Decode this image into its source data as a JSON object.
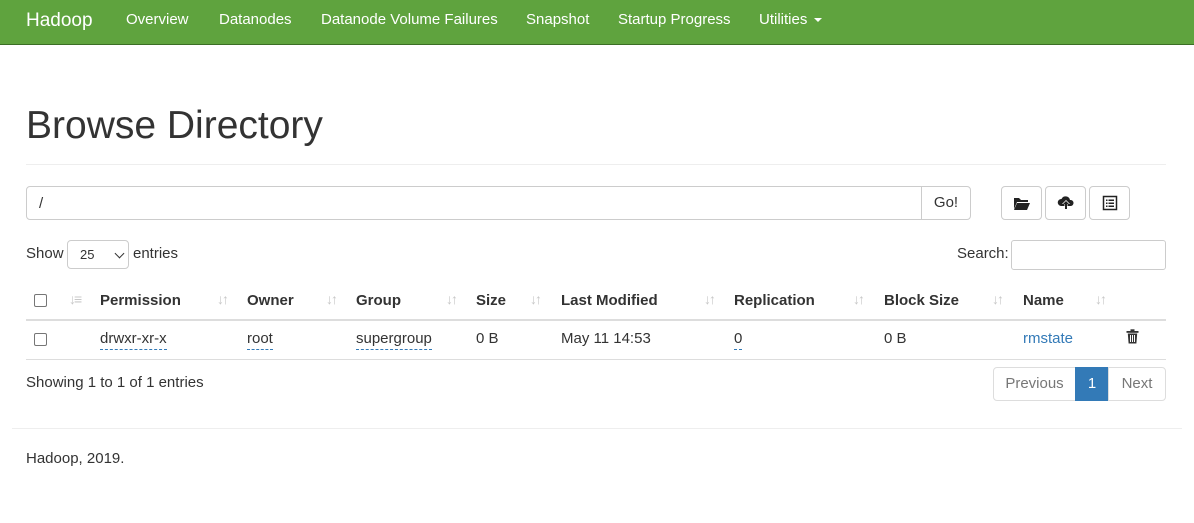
{
  "navbar": {
    "brand": "Hadoop",
    "items": [
      "Overview",
      "Datanodes",
      "Datanode Volume Failures",
      "Snapshot",
      "Startup Progress",
      "Utilities"
    ]
  },
  "page": {
    "title": "Browse Directory"
  },
  "path_bar": {
    "value": "/",
    "go_label": "Go!"
  },
  "toolbar": {
    "create_dir_icon": "folder-open-icon",
    "upload_icon": "cloud-upload-icon",
    "cut_paste_icon": "list-alt-icon"
  },
  "table_controls": {
    "show_label": "Show",
    "entries_value": "25",
    "entries_label": "entries",
    "search_label": "Search:",
    "search_value": ""
  },
  "table": {
    "columns": [
      "Permission",
      "Owner",
      "Group",
      "Size",
      "Last Modified",
      "Replication",
      "Block Size",
      "Name"
    ],
    "rows": [
      {
        "permission": "drwxr-xr-x",
        "owner": "root",
        "group": "supergroup",
        "size": "0 B",
        "last_modified": "May 11 14:53",
        "replication": "0",
        "block_size": "0 B",
        "name": "rmstate"
      }
    ]
  },
  "info": "Showing 1 to 1 of 1 entries",
  "pagination": {
    "previous": "Previous",
    "current": "1",
    "next": "Next"
  },
  "footer": "Hadoop, 2019.",
  "colors": {
    "navbar": "#5fa33e",
    "link": "#337ab7",
    "active_page": "#337ab7"
  }
}
